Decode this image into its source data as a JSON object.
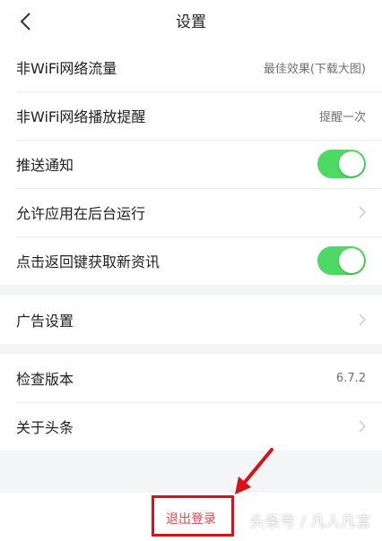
{
  "header": {
    "title": "设置",
    "back_icon": "chevron-left-icon"
  },
  "group_network": {
    "items": [
      {
        "label": "非WiFi网络流量",
        "value": "最佳效果(下载大图)"
      },
      {
        "label": "非WiFi网络播放提醒",
        "value": "提醒一次"
      },
      {
        "label": "推送通知",
        "toggle_on": true
      },
      {
        "label": "允许应用在后台运行",
        "chevron": "chevron-right-icon"
      },
      {
        "label": "点击返回键获取新资讯",
        "toggle_on": true
      }
    ]
  },
  "group_ads": {
    "items": [
      {
        "label": "广告设置",
        "chevron": "chevron-right-icon"
      }
    ]
  },
  "group_about": {
    "items": [
      {
        "label": "检查版本",
        "value": "6.7.2"
      },
      {
        "label": "关于头条",
        "chevron": "chevron-right-icon"
      }
    ]
  },
  "logout": {
    "label": "退出登录"
  },
  "watermark": {
    "text": "头条号 / 凡人凡言"
  },
  "colors": {
    "toggle_on": "#4cd964",
    "logout_text": "#e4464b",
    "annotation_red": "#d8121a",
    "page_background": "#f4f5f6"
  }
}
